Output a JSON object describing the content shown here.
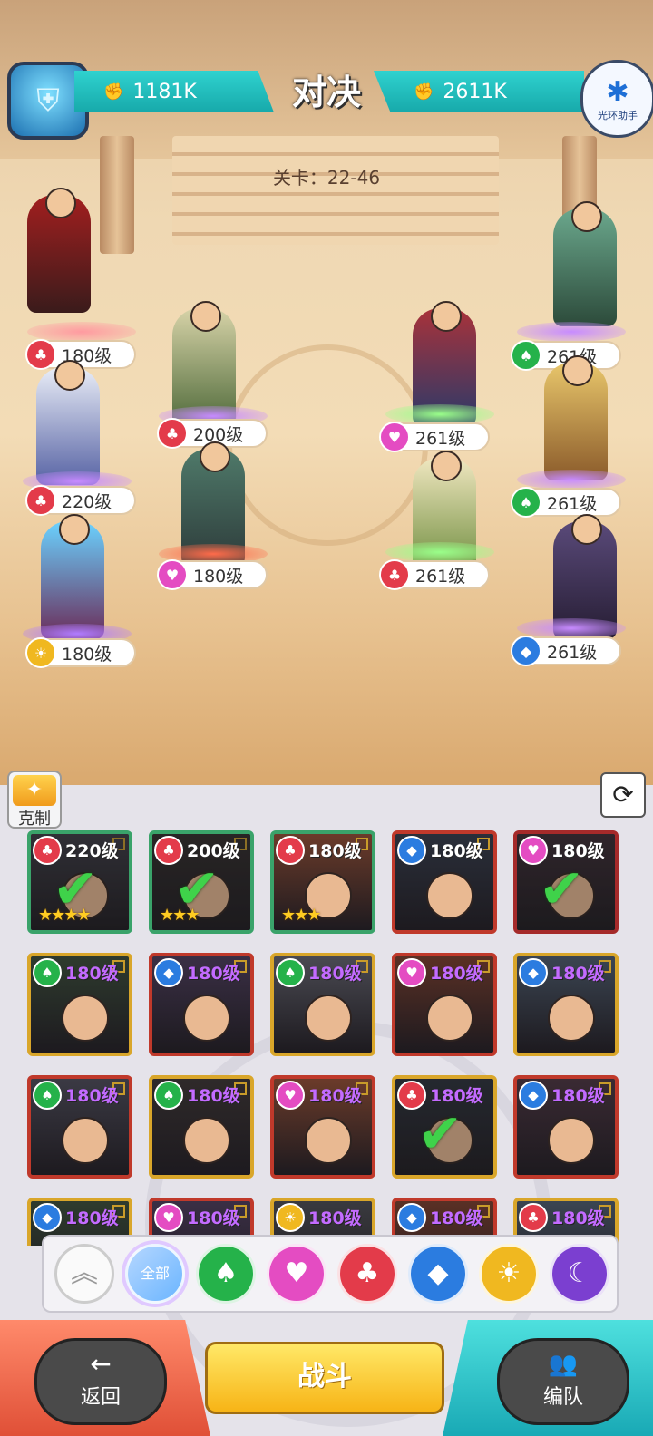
{
  "header": {
    "title": "对决",
    "left_power": "1181K",
    "right_power": "2611K",
    "right_badge_caption": "光环助手",
    "stage_label": "关卡：22-46"
  },
  "colors": {
    "fire": "#e33b4a",
    "leaf": "#25b24a",
    "heart": "#e44cc2",
    "diamond": "#2b7ce0",
    "sun": "#f0b820",
    "moon": "#7b3fd0"
  },
  "ally_levels": [
    "180级",
    "200级",
    "220级",
    "180级",
    "180级"
  ],
  "enemy_levels": [
    "261级",
    "261级",
    "261级",
    "261级",
    "261级"
  ],
  "ally_elements": [
    "fire",
    "fire",
    "fire",
    "heart",
    "sun"
  ],
  "enemy_elements": [
    "leaf",
    "heart",
    "leaf",
    "fire",
    "diamond"
  ],
  "panel": {
    "counter_label": "克制"
  },
  "roster": [
    {
      "level": "220级",
      "element": "fire",
      "selected": true,
      "stars": "★★★★"
    },
    {
      "level": "200级",
      "element": "fire",
      "selected": true,
      "stars": "★★★"
    },
    {
      "level": "180级",
      "element": "fire",
      "selected": false,
      "stars": "★★★"
    },
    {
      "level": "180级",
      "element": "diamond",
      "selected": false,
      "stars": ""
    },
    {
      "level": "180级",
      "element": "heart",
      "selected": true,
      "stars": ""
    },
    {
      "level": "180级",
      "element": "leaf",
      "selected": false,
      "stars": ""
    },
    {
      "level": "180级",
      "element": "diamond",
      "selected": false,
      "stars": ""
    },
    {
      "level": "180级",
      "element": "leaf",
      "selected": false,
      "stars": ""
    },
    {
      "level": "180级",
      "element": "heart",
      "selected": false,
      "stars": ""
    },
    {
      "level": "180级",
      "element": "diamond",
      "selected": false,
      "stars": ""
    },
    {
      "level": "180级",
      "element": "leaf",
      "selected": false,
      "stars": ""
    },
    {
      "level": "180级",
      "element": "leaf",
      "selected": false,
      "stars": ""
    },
    {
      "level": "180级",
      "element": "heart",
      "selected": false,
      "stars": ""
    },
    {
      "level": "180级",
      "element": "fire",
      "selected": true,
      "stars": ""
    },
    {
      "level": "180级",
      "element": "diamond",
      "selected": false,
      "stars": ""
    },
    {
      "level": "180级",
      "element": "diamond",
      "selected": false,
      "stars": ""
    },
    {
      "level": "180级",
      "element": "heart",
      "selected": false,
      "stars": ""
    },
    {
      "level": "180级",
      "element": "sun",
      "selected": true,
      "stars": ""
    },
    {
      "level": "180级",
      "element": "diamond",
      "selected": false,
      "stars": ""
    },
    {
      "level": "180级",
      "element": "fire",
      "selected": false,
      "stars": ""
    }
  ],
  "filters": {
    "all_label": "全部"
  },
  "bottom": {
    "back_label": "返回",
    "fight_label": "战斗",
    "team_label": "编队"
  }
}
